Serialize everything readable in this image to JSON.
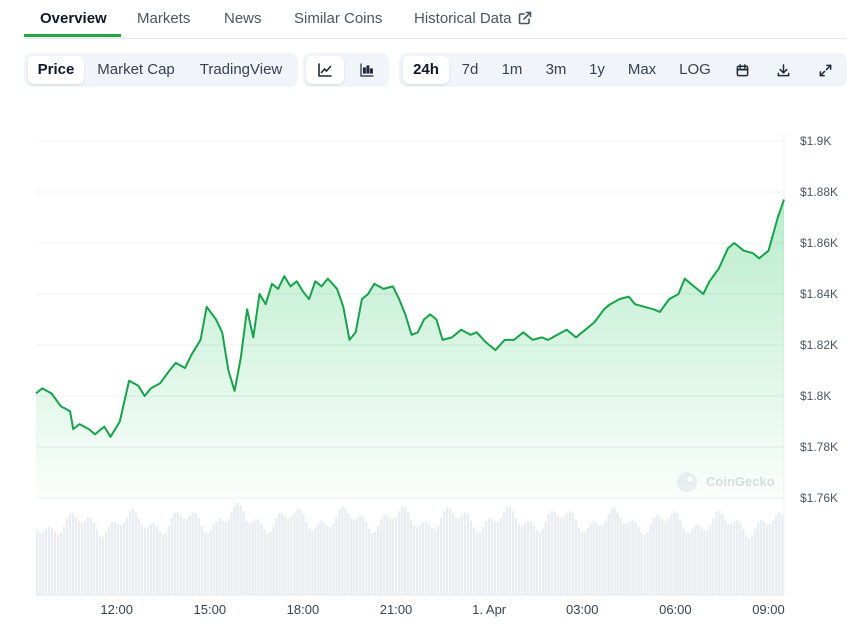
{
  "tabs": [
    {
      "label": "Overview",
      "active": true
    },
    {
      "label": "Markets"
    },
    {
      "label": "News"
    },
    {
      "label": "Similar Coins"
    },
    {
      "label": "Historical Data",
      "external": true
    }
  ],
  "chart_type_buttons": [
    {
      "label": "Price",
      "active": true
    },
    {
      "label": "Market Cap"
    },
    {
      "label": "TradingView"
    }
  ],
  "view_buttons": [
    {
      "icon": "line-chart-icon",
      "active": true
    },
    {
      "icon": "candlestick-chart-icon"
    }
  ],
  "range_buttons": [
    {
      "label": "24h",
      "active": true
    },
    {
      "label": "7d"
    },
    {
      "label": "1m"
    },
    {
      "label": "3m"
    },
    {
      "label": "1y"
    },
    {
      "label": "Max"
    },
    {
      "label": "LOG"
    }
  ],
  "tool_icons": [
    "calendar-icon",
    "download-icon",
    "fullscreen-icon"
  ],
  "colors": {
    "accent": "#22a843",
    "line": "#16a34a"
  },
  "chart_data": {
    "type": "area",
    "x_ticks": [
      "12:00",
      "15:00",
      "18:00",
      "21:00",
      "1. Apr",
      "03:00",
      "06:00",
      "09:00"
    ],
    "x_tick_hours": [
      2,
      5,
      8,
      11,
      14,
      17,
      20,
      23
    ],
    "x_start_hour": -0.6,
    "x_end_hour": 23.5,
    "y_ticks": [
      "$1.9K",
      "$1.88K",
      "$1.86K",
      "$1.84K",
      "$1.82K",
      "$1.8K",
      "$1.78K",
      "$1.76K"
    ],
    "y_tick_values": [
      1900,
      1880,
      1860,
      1840,
      1820,
      1800,
      1780,
      1760
    ],
    "ylim": [
      1760,
      1900
    ],
    "grid": true,
    "price_series": [
      [
        -0.6,
        1801
      ],
      [
        -0.4,
        1803
      ],
      [
        -0.1,
        1801
      ],
      [
        0.2,
        1796
      ],
      [
        0.5,
        1794
      ],
      [
        0.6,
        1787
      ],
      [
        0.8,
        1789
      ],
      [
        1.1,
        1787
      ],
      [
        1.3,
        1785
      ],
      [
        1.6,
        1788
      ],
      [
        1.8,
        1784
      ],
      [
        2.1,
        1790
      ],
      [
        2.4,
        1806
      ],
      [
        2.7,
        1804
      ],
      [
        2.9,
        1800
      ],
      [
        3.1,
        1803
      ],
      [
        3.4,
        1805
      ],
      [
        3.7,
        1810
      ],
      [
        3.9,
        1813
      ],
      [
        4.2,
        1811
      ],
      [
        4.4,
        1816
      ],
      [
        4.7,
        1822
      ],
      [
        4.9,
        1835
      ],
      [
        5.2,
        1830
      ],
      [
        5.4,
        1825
      ],
      [
        5.6,
        1810
      ],
      [
        5.8,
        1802
      ],
      [
        6.0,
        1815
      ],
      [
        6.2,
        1834
      ],
      [
        6.4,
        1823
      ],
      [
        6.6,
        1840
      ],
      [
        6.8,
        1836
      ],
      [
        7.0,
        1844
      ],
      [
        7.2,
        1842
      ],
      [
        7.4,
        1847
      ],
      [
        7.6,
        1843
      ],
      [
        7.8,
        1845
      ],
      [
        8.0,
        1841
      ],
      [
        8.2,
        1838
      ],
      [
        8.4,
        1845
      ],
      [
        8.6,
        1843
      ],
      [
        8.8,
        1846
      ],
      [
        9.1,
        1842
      ],
      [
        9.3,
        1835
      ],
      [
        9.5,
        1822
      ],
      [
        9.7,
        1825
      ],
      [
        9.9,
        1838
      ],
      [
        10.1,
        1840
      ],
      [
        10.3,
        1844
      ],
      [
        10.6,
        1842
      ],
      [
        10.9,
        1843
      ],
      [
        11.1,
        1838
      ],
      [
        11.3,
        1832
      ],
      [
        11.5,
        1824
      ],
      [
        11.7,
        1825
      ],
      [
        11.9,
        1830
      ],
      [
        12.1,
        1832
      ],
      [
        12.3,
        1830
      ],
      [
        12.5,
        1822
      ],
      [
        12.8,
        1823
      ],
      [
        13.1,
        1826
      ],
      [
        13.4,
        1824
      ],
      [
        13.6,
        1825
      ],
      [
        13.9,
        1821
      ],
      [
        14.2,
        1818
      ],
      [
        14.5,
        1822
      ],
      [
        14.8,
        1822
      ],
      [
        15.1,
        1825
      ],
      [
        15.4,
        1822
      ],
      [
        15.7,
        1823
      ],
      [
        15.9,
        1822
      ],
      [
        16.2,
        1824
      ],
      [
        16.5,
        1826
      ],
      [
        16.8,
        1823
      ],
      [
        17.1,
        1826
      ],
      [
        17.4,
        1829
      ],
      [
        17.7,
        1834
      ],
      [
        17.9,
        1836
      ],
      [
        18.2,
        1838
      ],
      [
        18.5,
        1839
      ],
      [
        18.7,
        1836
      ],
      [
        19.0,
        1835
      ],
      [
        19.3,
        1834
      ],
      [
        19.5,
        1833
      ],
      [
        19.8,
        1838
      ],
      [
        20.1,
        1840
      ],
      [
        20.3,
        1846
      ],
      [
        20.6,
        1843
      ],
      [
        20.9,
        1840
      ],
      [
        21.1,
        1845
      ],
      [
        21.4,
        1850
      ],
      [
        21.7,
        1858
      ],
      [
        21.9,
        1860
      ],
      [
        22.2,
        1857
      ],
      [
        22.5,
        1856
      ],
      [
        22.7,
        1854
      ],
      [
        23.0,
        1857
      ],
      [
        23.3,
        1870
      ],
      [
        23.5,
        1877
      ]
    ]
  },
  "watermark": {
    "text": "CoinGecko"
  }
}
